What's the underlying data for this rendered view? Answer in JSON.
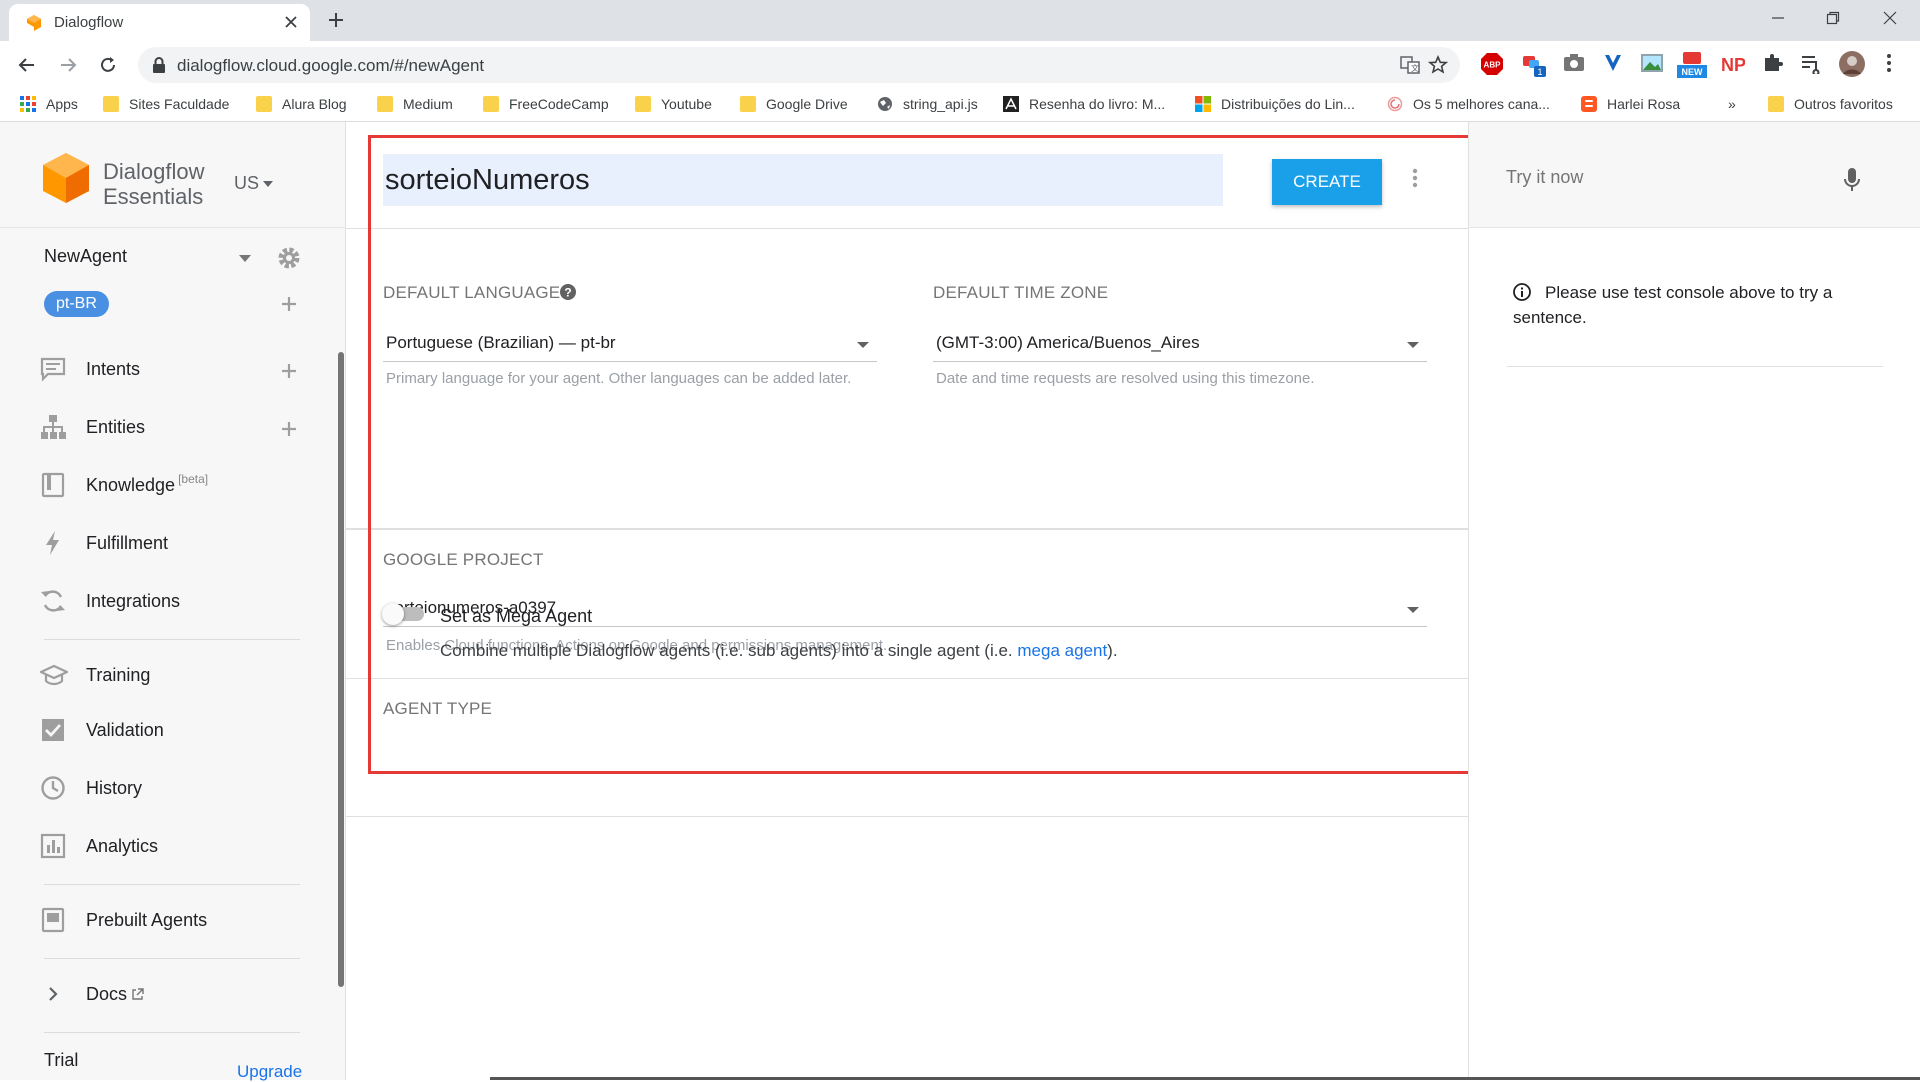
{
  "browser": {
    "tab_title": "Dialogflow",
    "url": "dialogflow.cloud.google.com/#/newAgent",
    "bookmarks": [
      {
        "label": "Apps",
        "icon": "apps-grid-icon"
      },
      {
        "label": "Sites Faculdade",
        "icon": "folder-icon"
      },
      {
        "label": "Alura Blog",
        "icon": "folder-icon"
      },
      {
        "label": "Medium",
        "icon": "folder-icon"
      },
      {
        "label": "FreeCodeCamp",
        "icon": "folder-icon"
      },
      {
        "label": "Youtube",
        "icon": "folder-icon"
      },
      {
        "label": "Google Drive",
        "icon": "folder-icon"
      },
      {
        "label": "string_api.js",
        "icon": "globe-icon"
      },
      {
        "label": "Resenha do livro: M...",
        "icon": "book-logo-icon"
      },
      {
        "label": "Distribuições do Lin...",
        "icon": "windows-logo-icon"
      },
      {
        "label": "Os 5 melhores cana...",
        "icon": "swirl-icon"
      },
      {
        "label": "Harlei Rosa",
        "icon": "blogger-icon"
      }
    ],
    "overflow_label": "»",
    "other_bookmarks": "Outros favoritos",
    "extensions": {
      "abp": "ABP",
      "badge": "1",
      "new_badge": "NEW",
      "np": "NP"
    }
  },
  "sidebar": {
    "brand_line1": "Dialogflow",
    "brand_line2": "Essentials",
    "region": "US",
    "agent_name": "NewAgent",
    "language_chip": "pt-BR",
    "menu": [
      {
        "label": "Intents",
        "icon": "intents-icon"
      },
      {
        "label": "Entities",
        "icon": "entities-icon"
      },
      {
        "label": "Knowledge",
        "icon": "knowledge-icon",
        "badge": "[beta]"
      },
      {
        "label": "Fulfillment",
        "icon": "fulfillment-icon"
      },
      {
        "label": "Integrations",
        "icon": "integrations-icon"
      },
      {
        "label": "Training",
        "icon": "training-icon"
      },
      {
        "label": "Validation",
        "icon": "validation-icon"
      },
      {
        "label": "History",
        "icon": "history-icon"
      },
      {
        "label": "Analytics",
        "icon": "analytics-icon"
      },
      {
        "label": "Prebuilt Agents",
        "icon": "prebuilt-agents-icon"
      },
      {
        "label": "Docs",
        "icon": "chevron-right-icon"
      }
    ],
    "trial": "Trial",
    "upgrade": "Upgrade"
  },
  "form": {
    "agent_name_value": "sorteioNumeros",
    "create_label": "CREATE",
    "default_language": {
      "label": "DEFAULT LANGUAGE",
      "value": "Portuguese (Brazilian) — pt-br",
      "hint": "Primary language for your agent. Other languages can be added later."
    },
    "default_time_zone": {
      "label": "DEFAULT TIME ZONE",
      "value": "(GMT-3:00) America/Buenos_Aires",
      "hint": "Date and time requests are resolved using this timezone."
    },
    "google_project": {
      "label": "GOOGLE PROJECT",
      "value": "sorteionumeros-a0397",
      "hint": "Enables Cloud functions, Actions on Google and permissions management."
    },
    "agent_type": {
      "label": "AGENT TYPE",
      "toggle_label": "Set as Mega Agent",
      "toggle_on": false,
      "desc_before": "Combine multiple Dialogflow agents (i.e. sub agents) into a single agent (i.e. ",
      "desc_link": "mega agent",
      "desc_after": ")."
    }
  },
  "test_console": {
    "placeholder": "Try it now",
    "info": "Please use test console above to try a sentence."
  },
  "colors": {
    "accent": "#1a9fe9",
    "highlight_box": "#e53935",
    "chip": "#4a90e2",
    "logo": "#ff9800"
  }
}
